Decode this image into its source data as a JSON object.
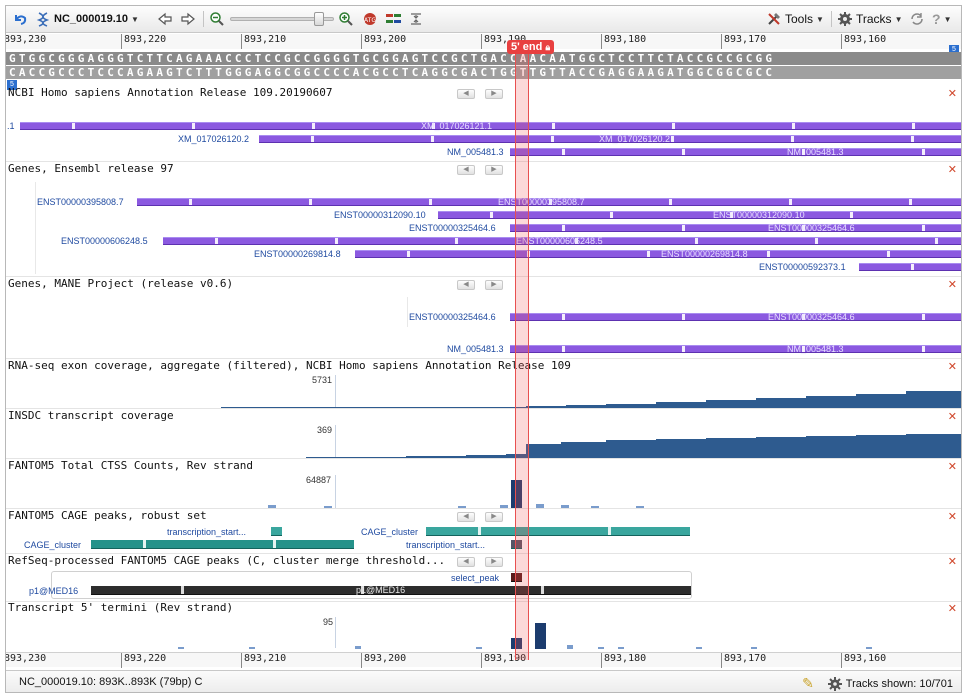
{
  "toolbar": {
    "accession": "NC_000019.10",
    "tools_label": "Tools",
    "tracks_label": "Tracks"
  },
  "ruler": {
    "ticks": [
      "893,230",
      "893,220",
      "893,210",
      "893,200",
      "893,190",
      "893,180",
      "893,170",
      "893,160"
    ]
  },
  "marker": {
    "label": "5' end"
  },
  "sequence": {
    "forward": "GTGGCGGGAGGGTCTTCAGAAACCCTCCGCCGGGGTGCGGAGTCCGCTGACCAACAATGGCTCCTTCTACCGCCGCGG",
    "reverse": "CACCGCCCTCCCAGAAGTCTTTGGGAGGCGGCCCCACGCCTCAGGCGACTGGTTGTTACCGAGGAAGATGGCGGCGCC"
  },
  "tracks": {
    "ncbi": {
      "title": "NCBI Homo sapiens Annotation Release 109.20190607",
      "left_label": ".1",
      "xm1": "XM_017026121.1",
      "xm2_left": "XM_017026120.2",
      "xm2_right": "XM_017026120.2",
      "nm_left": "NM_005481.3",
      "nm_right": "NM_005481.3"
    },
    "ensembl": {
      "title": "Genes, Ensembl release 97",
      "t1": "ENST00000395808.7",
      "t2": "ENST00000312090.10",
      "t3": "ENST00000325464.6",
      "t4": "ENST00000606248.5",
      "t5": "ENST00000269814.8",
      "t6": "ENST00000592373.1"
    },
    "mane": {
      "title": "Genes, MANE Project (release v0.6)",
      "t1": "ENST00000325464.6",
      "t2": "NM_005481.3"
    },
    "rnaseq": {
      "title": "RNA-seq exon coverage, aggregate (filtered), NCBI Homo sapiens Annotation Release 109",
      "max": "5731"
    },
    "insdc": {
      "title": "INSDC transcript coverage",
      "max": "369"
    },
    "ctss": {
      "title": "FANTOM5 Total CTSS Counts, Rev strand",
      "max": "64887"
    },
    "cage": {
      "title": "FANTOM5 CAGE peaks, robust set",
      "l1": "transcription_start...",
      "l2": "CAGE_cluster",
      "l3": "CAGE_cluster",
      "l4": "transcription_start..."
    },
    "refseqcage": {
      "title": "RefSeq-processed FANTOM5 CAGE peaks (C, cluster merge threshold...",
      "select_peak": "select_peak",
      "p1_left": "p1@MED16",
      "p1_center": "p1@MED16"
    },
    "termini": {
      "title": "Transcript 5' termini (Rev strand)",
      "max": "95"
    }
  },
  "status": {
    "location": "NC_000019.10: 893K..893K (79bp) C",
    "tracks_shown": "Tracks shown: 10/701"
  },
  "colors": {
    "feature": "#8b59e0",
    "teal": "#25928a",
    "highlight": "#e84040",
    "coverage": "#2e5b8f"
  }
}
